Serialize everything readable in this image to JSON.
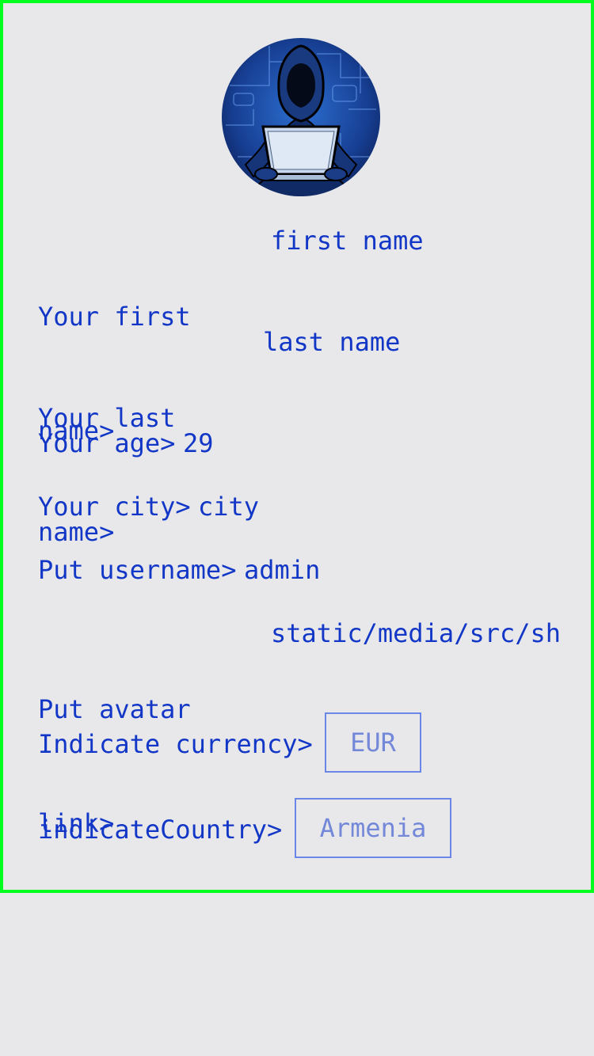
{
  "profile": {
    "avatar_icon": "hooded-hacker-laptop-avatar"
  },
  "form": {
    "first_name": {
      "label_line1": "Your first",
      "label_line2": "name>",
      "value": "first name"
    },
    "last_name": {
      "label_line1": "Your last",
      "label_line2": "name>",
      "value": "last name"
    },
    "age": {
      "label": "Your age>",
      "value": "29"
    },
    "city": {
      "label": "Your city>",
      "value": "city"
    },
    "username": {
      "label": "Put username>",
      "value": "admin"
    },
    "avatar_link": {
      "label_line1": "Put avatar",
      "label_line2": "link>",
      "value": "static/media/src/sha"
    },
    "currency": {
      "label": "Indicate currency>",
      "value": "EUR"
    },
    "country": {
      "label": "indicateCountry>",
      "value": "Armenia"
    }
  },
  "colors": {
    "text": "#1237c7",
    "border_accent": "#00ff1e",
    "select_border": "#6b86e6",
    "background": "#e8e8ea"
  }
}
